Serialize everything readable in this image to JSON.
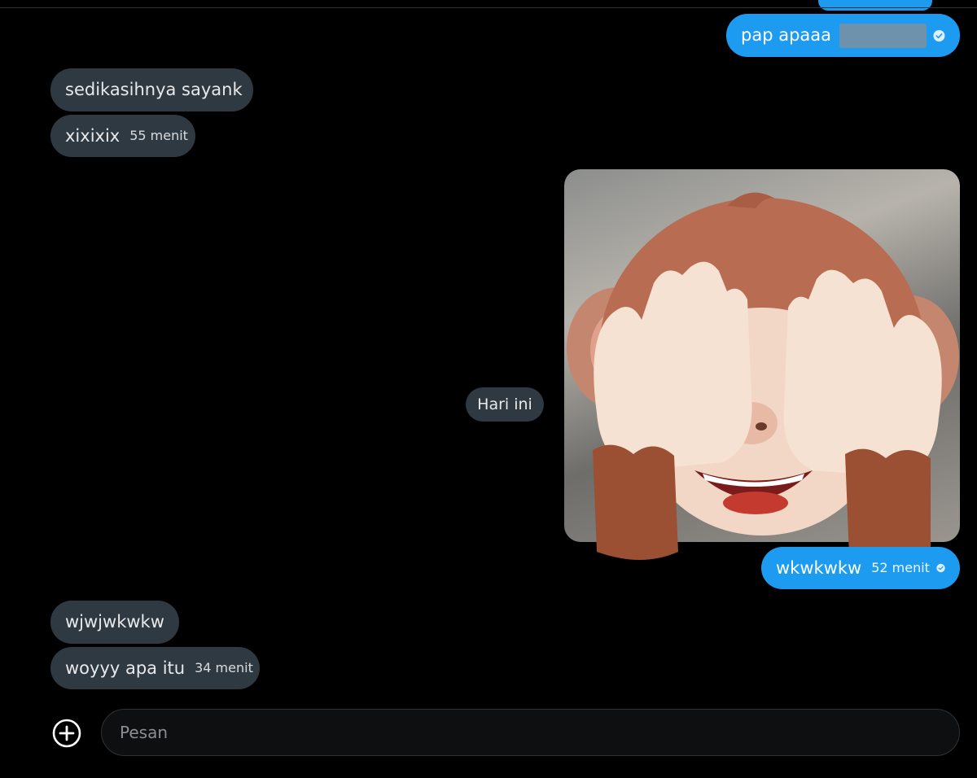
{
  "messages": [
    {
      "id": "m1",
      "direction": "outgoing",
      "text": "pap apaaa",
      "redacted": true,
      "read": true
    },
    {
      "id": "m2",
      "direction": "incoming",
      "text": "sedikasihnya sayank"
    },
    {
      "id": "m3",
      "direction": "incoming",
      "text": "xixixix",
      "time": "55 menit"
    },
    {
      "id": "m4",
      "direction": "outgoing",
      "type": "image",
      "image_subject": "see-no-evil monkey memoji",
      "read": true
    },
    {
      "id": "m5",
      "direction": "outgoing",
      "text": "wkwkwkw",
      "time": "52 menit",
      "read": true
    },
    {
      "id": "m6",
      "direction": "incoming",
      "text": "wjwjwkwkw"
    },
    {
      "id": "m7",
      "direction": "incoming",
      "text": "woyyy apa itu",
      "time": "34 menit"
    }
  ],
  "date_separator": "Hari ini",
  "composer": {
    "placeholder": "Pesan",
    "add_icon": "plus-circle-icon"
  },
  "colors": {
    "background": "#000000",
    "outgoing_bubble": "#1d9bf0",
    "incoming_bubble": "#2f3942",
    "text": "#e7e9ea"
  }
}
